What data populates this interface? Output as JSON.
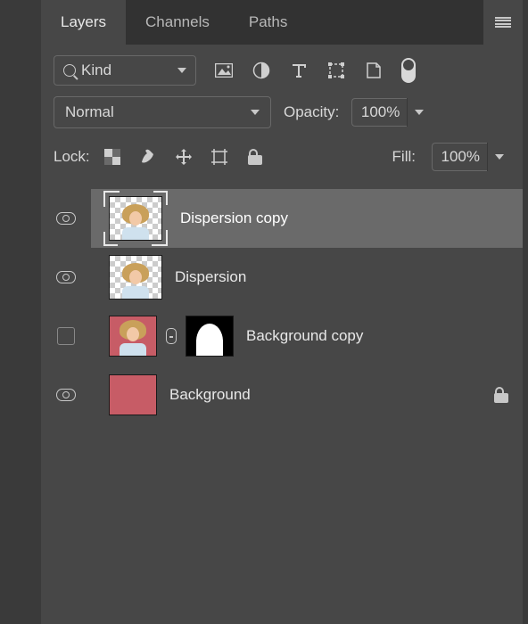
{
  "tabs": [
    {
      "label": "Layers",
      "active": true
    },
    {
      "label": "Channels",
      "active": false
    },
    {
      "label": "Paths",
      "active": false
    }
  ],
  "filter": {
    "label": "Kind"
  },
  "blend": {
    "mode": "Normal",
    "opacity_label": "Opacity:",
    "opacity_value": "100%"
  },
  "lock": {
    "label": "Lock:",
    "fill_label": "Fill:",
    "fill_value": "100%"
  },
  "layers": [
    {
      "name": "Dispersion copy",
      "visible": true,
      "selected": true,
      "type": "transparent-person",
      "mask": false,
      "locked": false
    },
    {
      "name": "Dispersion",
      "visible": true,
      "selected": false,
      "type": "transparent-person",
      "mask": false,
      "locked": false
    },
    {
      "name": "Background copy",
      "visible": false,
      "selected": false,
      "type": "rose-person",
      "mask": true,
      "locked": false
    },
    {
      "name": "Background",
      "visible": true,
      "selected": false,
      "type": "rose-solid",
      "mask": false,
      "locked": true
    }
  ]
}
